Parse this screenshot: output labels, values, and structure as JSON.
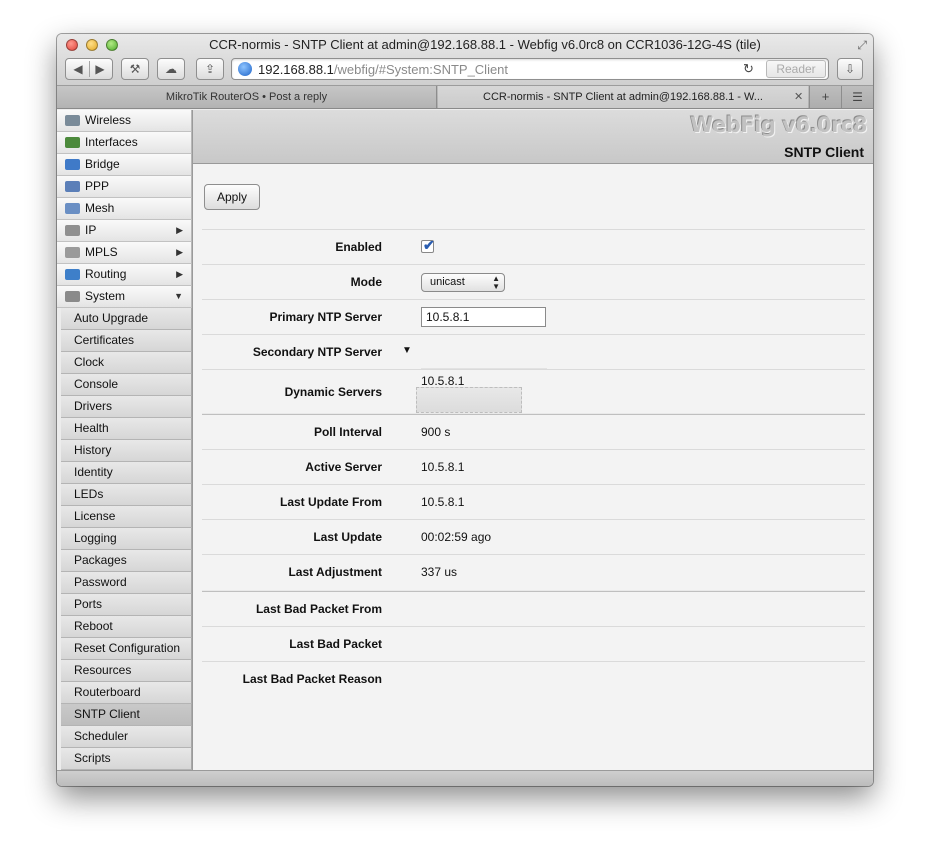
{
  "window": {
    "title": "CCR-normis - SNTP Client at admin@192.168.88.1 - Webfig v6.0rc8 on CCR1036-12G-4S (tile)"
  },
  "toolbar": {
    "back_icon": "◀",
    "forward_icon": "▶",
    "tools_icon": "⚒",
    "cloud_icon": "☁",
    "share_icon": "⇪",
    "download_icon": "⇩",
    "reload_icon": "↻",
    "reader_label": "Reader",
    "url_host": "192.168.88.1",
    "url_path": "/webfig/#System:SNTP_Client"
  },
  "tabs": [
    {
      "label": "MikroTik RouterOS • Post a reply"
    },
    {
      "label": "CCR-normis - SNTP Client at admin@192.168.88.1 - W..."
    }
  ],
  "tab_controls": {
    "close": "✕",
    "add": "+",
    "list": "☰"
  },
  "header": {
    "brand": "WebFig v6.0rc8",
    "page_title": "SNTP Client"
  },
  "sidebar": {
    "items": [
      {
        "label": "Wireless",
        "icon": "wireless-icon",
        "color": "#7a8b99",
        "arrow": ""
      },
      {
        "label": "Interfaces",
        "icon": "interfaces-icon",
        "color": "#4c8a3c",
        "arrow": ""
      },
      {
        "label": "Bridge",
        "icon": "bridge-icon",
        "color": "#3f7ac8",
        "arrow": ""
      },
      {
        "label": "PPP",
        "icon": "ppp-icon",
        "color": "#5b7fb8",
        "arrow": ""
      },
      {
        "label": "Mesh",
        "icon": "mesh-icon",
        "color": "#6a8fc4",
        "arrow": ""
      },
      {
        "label": "IP",
        "icon": "ip-icon",
        "color": "#8f8f8f",
        "arrow": "▶"
      },
      {
        "label": "MPLS",
        "icon": "mpls-icon",
        "color": "#9a9a9a",
        "arrow": "▶"
      },
      {
        "label": "Routing",
        "icon": "routing-icon",
        "color": "#3e7fc9",
        "arrow": "▶"
      },
      {
        "label": "System",
        "icon": "system-icon",
        "color": "#8a8a8a",
        "arrow": "▼"
      }
    ],
    "sub_items": [
      "Auto Upgrade",
      "Certificates",
      "Clock",
      "Console",
      "Drivers",
      "Health",
      "History",
      "Identity",
      "LEDs",
      "License",
      "Logging",
      "Packages",
      "Password",
      "Ports",
      "Reboot",
      "Reset Configuration",
      "Resources",
      "Routerboard",
      "SNTP Client",
      "Scheduler",
      "Scripts"
    ],
    "active": "SNTP Client"
  },
  "form": {
    "apply_label": "Apply",
    "enabled_label": "Enabled",
    "enabled_value": "✔",
    "mode_label": "Mode",
    "mode_value": "unicast",
    "mode_arrows": "▲▼",
    "primary_label": "Primary NTP Server",
    "primary_value": "10.5.8.1",
    "secondary_label": "Secondary NTP Server",
    "secondary_toggle": "▼",
    "dynamic_label": "Dynamic Servers",
    "dynamic_value": "10.5.8.1",
    "poll_label": "Poll Interval",
    "poll_value": "900 s",
    "active_label": "Active Server",
    "active_value": "10.5.8.1",
    "last_update_from_label": "Last Update From",
    "last_update_from_value": "10.5.8.1",
    "last_update_label": "Last Update",
    "last_update_value": "00:02:59 ago",
    "last_adjustment_label": "Last Adjustment",
    "last_adjustment_value": "337 us",
    "bad_from_label": "Last Bad Packet From",
    "bad_packet_label": "Last Bad Packet",
    "bad_reason_label": "Last Bad Packet Reason"
  }
}
